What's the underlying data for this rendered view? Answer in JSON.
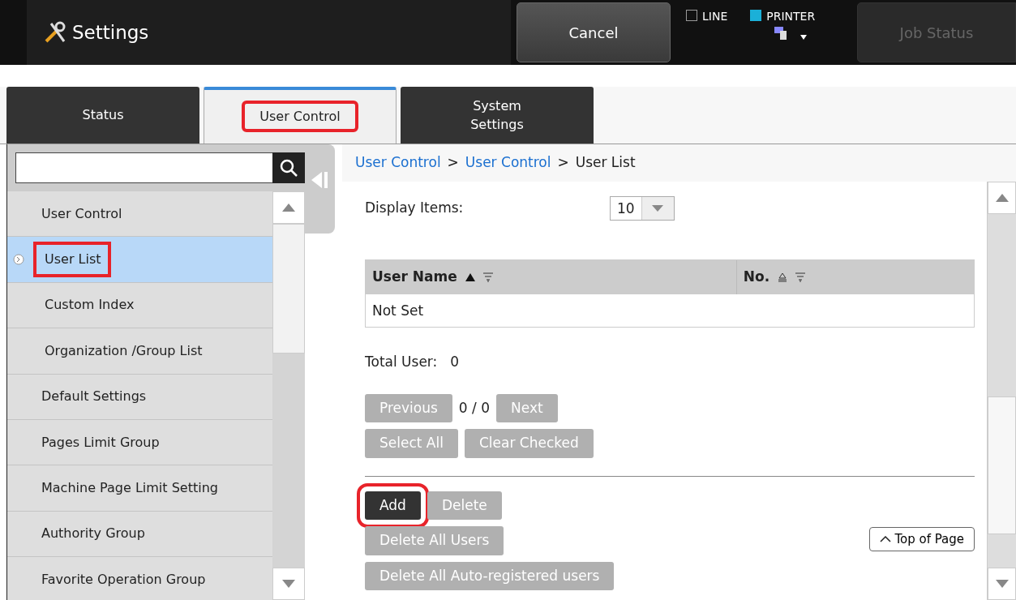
{
  "header": {
    "title": "Settings",
    "cancel": "Cancel",
    "line": {
      "label": "LINE",
      "checked": false
    },
    "printer": {
      "label": "PRINTER",
      "checked": true
    },
    "job_status": {
      "label": "Job Status",
      "disabled": true
    }
  },
  "tabs": [
    {
      "label": "Status",
      "selected": false,
      "highlighted": false
    },
    {
      "label": "User Control",
      "selected": true,
      "highlighted": true
    },
    {
      "label": "System\nSettings",
      "selected": false,
      "highlighted": false
    }
  ],
  "sidebar": {
    "items": [
      {
        "label": "User Control",
        "selected": false,
        "highlighted": false,
        "children": [
          {
            "label": "User List",
            "selected": true,
            "highlighted": true
          },
          {
            "label": "Custom Index",
            "selected": false,
            "highlighted": false
          },
          {
            "label": "Organization /Group List",
            "selected": false,
            "highlighted": false
          }
        ]
      },
      {
        "label": "Default Settings",
        "selected": false,
        "highlighted": false
      },
      {
        "label": "Pages Limit Group",
        "selected": false,
        "highlighted": false
      },
      {
        "label": "Machine Page Limit Setting",
        "selected": false,
        "highlighted": false
      },
      {
        "label": "Authority Group",
        "selected": false,
        "highlighted": false
      },
      {
        "label": "Favorite Operation Group",
        "selected": false,
        "highlighted": false
      }
    ]
  },
  "breadcrumb": {
    "separator": ">",
    "items": [
      {
        "label": "User Control",
        "kind": "link"
      },
      {
        "label": "User Control",
        "kind": "link"
      },
      {
        "label": "User List",
        "kind": "current"
      }
    ]
  },
  "display_items": {
    "label": "Display Items:",
    "value": "10"
  },
  "table": {
    "columns": [
      {
        "label": "User Name",
        "sorted": true
      },
      {
        "label": "No.",
        "sorted": false
      }
    ],
    "empty_text": "Not Set"
  },
  "total": {
    "label": "Total User:",
    "value": "0"
  },
  "pager": {
    "previous": {
      "label": "Previous",
      "disabled": true
    },
    "page": "0 / 0",
    "next": {
      "label": "Next",
      "disabled": true
    }
  },
  "selection_buttons": [
    {
      "label": "Select All",
      "disabled": true,
      "highlighted": false
    },
    {
      "label": "Clear Checked",
      "disabled": true,
      "highlighted": false
    }
  ],
  "action_rows": [
    [
      {
        "label": "Add",
        "disabled": false,
        "highlighted": true
      },
      {
        "label": "Delete",
        "disabled": true,
        "highlighted": false
      }
    ],
    [
      {
        "label": "Delete All Users",
        "disabled": true,
        "highlighted": false
      }
    ],
    [
      {
        "label": "Delete All Auto-registered users",
        "disabled": true,
        "highlighted": false
      }
    ]
  ],
  "top_of_page": "Top of Page"
}
